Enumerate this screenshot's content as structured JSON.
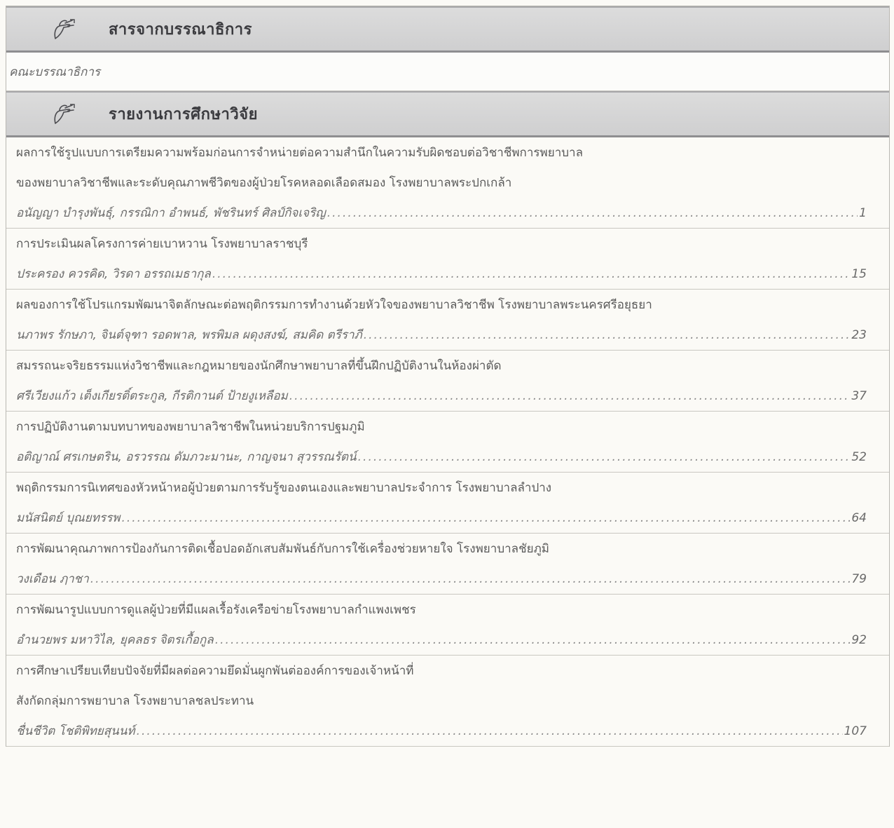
{
  "editorial": {
    "header": "สารจากบรรณาธิการ",
    "author": "คณะบรรณาธิการ"
  },
  "research": {
    "header": "รายงานการศึกษาวิจัย",
    "entries": [
      {
        "title_lines": [
          "ผลการใช้รูปแบบการเตรียมความพร้อมก่อนการจำหน่ายต่อความสำนึกในความรับผิดชอบต่อวิชาชีพการพยาบาล",
          "ของพยาบาลวิชาชีพและระดับคุณภาพชีวิตของผู้ป่วยโรคหลอดเลือดสมอง โรงพยาบาลพระปกเกล้า"
        ],
        "authors": "อนัญญา บำรุงพันธุ์, กรรณิกา อำพนธ์, พัชรินทร์ ศิลป์กิจเจริญ",
        "page": "1"
      },
      {
        "title_lines": [
          "การประเมินผลโครงการค่ายเบาหวาน โรงพยาบาลราชบุรี"
        ],
        "authors": "ประครอง ควรคิด, วิรดา อรรถเมธากุล",
        "page": "15"
      },
      {
        "title_lines": [
          "ผลของการใช้โปรแกรมพัฒนาจิตลักษณะต่อพฤติกรรมการทำงานด้วยหัวใจของพยาบาลวิชาชีพ โรงพยาบาลพระนครศรีอยุธยา"
        ],
        "authors": "นภาพร รักษภา, จินต์จุฑา รอดพาล, พรพิมล ผดุงสงฆ์, สมคิด ตรีราภี",
        "page": "23"
      },
      {
        "title_lines": [
          "สมรรถนะจริยธรรมแห่งวิชาชีพและกฎหมายของนักศึกษาพยาบาลที่ขึ้นฝึกปฏิบัติงานในห้องผ่าตัด"
        ],
        "authors": "ศรีเวียงแก้ว เต็งเกียรติ์ตระกูล, กีรติกานต์ ป้ายงูเหลือม",
        "page": "37"
      },
      {
        "title_lines": [
          "การปฏิบัติงานตามบทบาทของพยาบาลวิชาชีพในหน่วยบริการปฐมภูมิ"
        ],
        "authors": "อติญาณ์ ศรเกษตริน, อรวรรณ ดัมภวะมานะ, กาญจนา สุวรรณรัตน์",
        "page": "52"
      },
      {
        "title_lines": [
          "พฤติกรรมการนิเทศของหัวหน้าหอผู้ป่วยตามการรับรู้ของตนเองและพยาบาลประจำการ โรงพยาบาลลำปาง"
        ],
        "authors": "มนัสนิตย์ บุณยทรรพ",
        "page": "64"
      },
      {
        "title_lines": [
          "การพัฒนาคุณภาพการป้องกันการติดเชื้อปอดอักเสบสัมพันธ์กับการใช้เครื่องช่วยหายใจ โรงพยาบาลชัยภูมิ"
        ],
        "authors": "วงเดือน ฦาชา",
        "page": "79"
      },
      {
        "title_lines": [
          "การพัฒนารูปแบบการดูแลผู้ป่วยที่มีแผลเรื้อรังเครือข่ายโรงพยาบาลกำแพงเพชร"
        ],
        "authors": "อำนวยพร มหาวิไล, ยุคลธร จิตรเกื้อกูล",
        "page": "92"
      },
      {
        "title_lines": [
          "การศึกษาเปรียบเทียบปัจจัยที่มีผลต่อความยึดมั่นผูกพันต่อองค์การของเจ้าหน้าที่",
          "สังกัดกลุ่มการพยาบาล โรงพยาบาลชลประทาน"
        ],
        "authors": "ชื่นชีวิต โชติพิทยสุนนท์",
        "page": "107"
      }
    ]
  }
}
